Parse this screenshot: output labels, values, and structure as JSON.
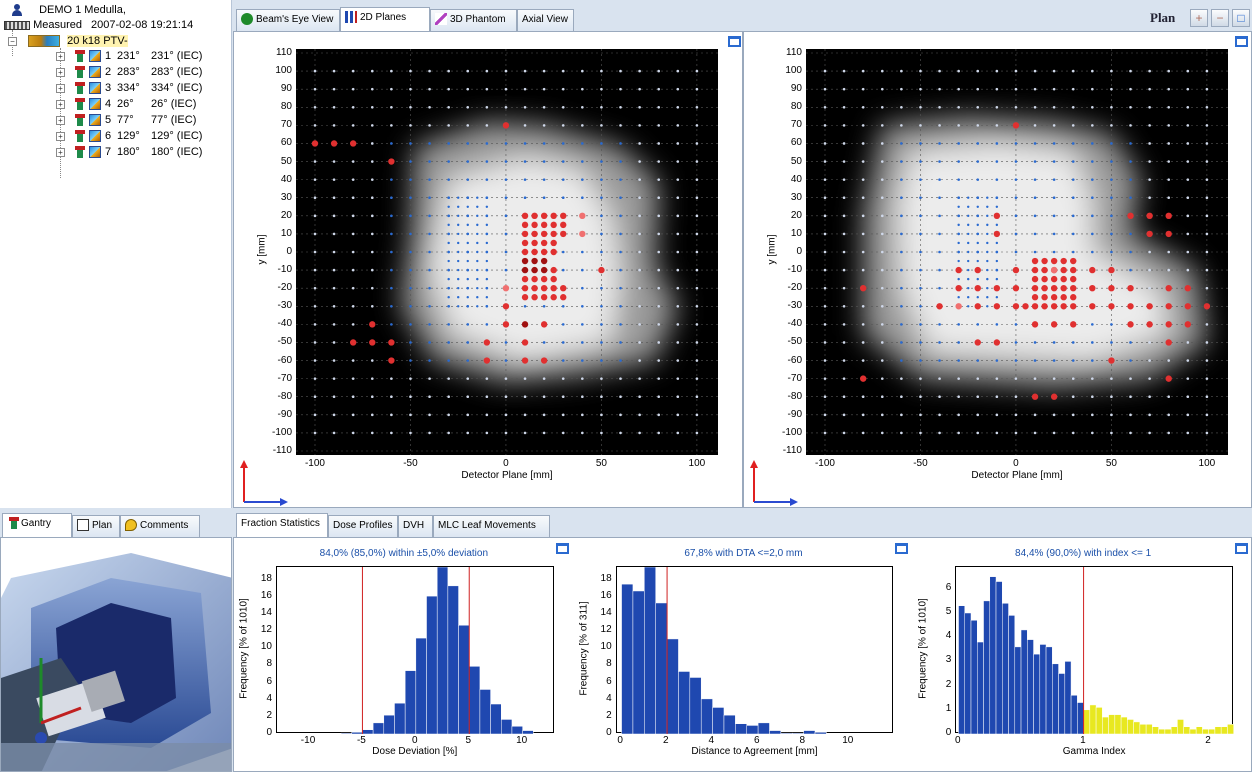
{
  "tree": {
    "patient": "DEMO 1  Medulla,",
    "measured_label": "Measured",
    "measured_time": "2007-02-08 19:21:14",
    "plan_name": "20 k18 PTV-",
    "fields": [
      {
        "id": "1",
        "angle": "231°",
        "iec": "231° (IEC)"
      },
      {
        "id": "2",
        "angle": "283°",
        "iec": "283° (IEC)"
      },
      {
        "id": "3",
        "angle": "334°",
        "iec": "334° (IEC)"
      },
      {
        "id": "4",
        "angle": "26°",
        "iec": "26° (IEC)"
      },
      {
        "id": "5",
        "angle": "77°",
        "iec": "77° (IEC)"
      },
      {
        "id": "6",
        "angle": "129°",
        "iec": "129° (IEC)"
      },
      {
        "id": "7",
        "angle": "180°",
        "iec": "180° (IEC)"
      }
    ]
  },
  "top_tabs": [
    "Beam's Eye View",
    "2D Planes",
    "3D Phantom",
    "Axial View"
  ],
  "active_top_tab": "2D Planes",
  "plan_title": "Plan",
  "planes": {
    "ylabel": "y [mm]",
    "xlabel": "Detector Plane [mm]",
    "y_ticks": [
      "110",
      "100",
      "90",
      "80",
      "70",
      "60",
      "50",
      "40",
      "30",
      "20",
      "10",
      "0",
      "-10",
      "-20",
      "-30",
      "-40",
      "-50",
      "-60",
      "-70",
      "-80",
      "-90",
      "-100",
      "-110"
    ],
    "x_ticks": [
      "-100",
      "-50",
      "0",
      "50",
      "100"
    ]
  },
  "left_tabs": [
    "Gantry",
    "Plan",
    "Comments"
  ],
  "stat_tabs": [
    "Fraction Statistics",
    "Dose Profiles",
    "DVH",
    "MLC Leaf Movements"
  ],
  "histograms": [
    {
      "title": "84,0% (85,0%) within ±5,0% deviation",
      "ylabel": "Frequency [% of 1010]",
      "xlabel": "Dose Deviation [%]",
      "x_ticks": [
        "-10",
        "-5",
        "0",
        "5",
        "10"
      ],
      "y_ticks": [
        "18",
        "16",
        "14",
        "12",
        "10",
        "8",
        "6",
        "4",
        "2",
        "0"
      ]
    },
    {
      "title": "67,8% with DTA <=2,0 mm",
      "ylabel": "Frequency [% of 311]",
      "xlabel": "Distance to Agreement [mm]",
      "x_ticks": [
        "0",
        "2",
        "4",
        "6",
        "8",
        "10"
      ],
      "y_ticks": [
        "18",
        "16",
        "14",
        "12",
        "10",
        "8",
        "6",
        "4",
        "2",
        "0"
      ]
    },
    {
      "title": "84,4% (90,0%) with index <= 1",
      "ylabel": "Frequency [% of 1010]",
      "xlabel": "Gamma Index",
      "x_ticks": [
        "0",
        "1",
        "2"
      ],
      "y_ticks": [
        "6",
        "5",
        "4",
        "3",
        "2",
        "1",
        "0"
      ]
    }
  ],
  "chart_data": [
    {
      "type": "bar",
      "xlim": [
        -13,
        13
      ],
      "ylim": [
        0,
        19.5
      ],
      "threshold_lines": [
        -5,
        5
      ],
      "bin_width": 1,
      "x": [
        -6.5,
        -5.5,
        -4.5,
        -3.5,
        -2.5,
        -1.5,
        -0.5,
        0.5,
        1.5,
        2.5,
        3.5,
        4.5,
        5.5,
        6.5,
        7.5,
        8.5,
        9.5,
        10.5
      ],
      "values": [
        0.1,
        0.2,
        0.5,
        1.3,
        2.2,
        3.6,
        7.4,
        11.2,
        16.1,
        19.5,
        17.3,
        12.7,
        7.9,
        5.2,
        3.5,
        1.7,
        0.9,
        0.4
      ],
      "xlabel": "Dose Deviation [%]",
      "ylabel": "Frequency [% of 1010]"
    },
    {
      "type": "bar",
      "xlim": [
        -0.2,
        12
      ],
      "ylim": [
        0,
        19.5
      ],
      "threshold_lines": [
        2
      ],
      "bin_width": 0.5,
      "x": [
        0.25,
        0.75,
        1.25,
        1.75,
        2.25,
        2.75,
        3.25,
        3.75,
        4.25,
        4.75,
        5.25,
        5.75,
        6.25,
        6.75,
        7.25,
        7.75,
        8.25,
        8.75
      ],
      "values": [
        17.5,
        16.7,
        19.5,
        15.3,
        11.1,
        7.3,
        6.6,
        4.1,
        3.1,
        2.2,
        1.2,
        1.0,
        1.3,
        0.4,
        0.1,
        0.1,
        0.4,
        0.2
      ],
      "xlabel": "Distance to Agreement [mm]",
      "ylabel": "Frequency [% of 311]"
    },
    {
      "type": "bar",
      "xlim": [
        -0.02,
        2.2
      ],
      "ylim": [
        0,
        6.9
      ],
      "threshold_lines": [
        1
      ],
      "bin_width": 0.05,
      "x": [
        0.025,
        0.075,
        0.125,
        0.175,
        0.225,
        0.275,
        0.325,
        0.375,
        0.425,
        0.475,
        0.525,
        0.575,
        0.625,
        0.675,
        0.725,
        0.775,
        0.825,
        0.875,
        0.925,
        0.975,
        1.025,
        1.075,
        1.125,
        1.175,
        1.225,
        1.275,
        1.325,
        1.375,
        1.425,
        1.475,
        1.525,
        1.575,
        1.625,
        1.675,
        1.725,
        1.775,
        1.825,
        1.875,
        1.925,
        1.975,
        2.025,
        2.075,
        2.125,
        2.175
      ],
      "values": [
        5.3,
        5.0,
        4.7,
        3.8,
        5.5,
        6.5,
        6.3,
        5.4,
        4.9,
        3.6,
        4.3,
        3.9,
        3.3,
        3.7,
        3.6,
        2.9,
        2.5,
        3.0,
        1.6,
        1.3,
        1.0,
        1.2,
        1.1,
        0.7,
        0.8,
        0.8,
        0.7,
        0.6,
        0.5,
        0.4,
        0.4,
        0.3,
        0.2,
        0.2,
        0.3,
        0.6,
        0.3,
        0.2,
        0.3,
        0.2,
        0.2,
        0.3,
        0.3,
        0.4
      ],
      "series": [
        {
          "name": "",
          "color": "#1f48b0"
        },
        {
          "name": "",
          "color": "#e8e820"
        }
      ],
      "xlabel": "Gamma Index",
      "ylabel": "Frequency [% of 1010]"
    }
  ],
  "colors": {
    "accent": "#1f48b0",
    "threshold": "#d02020",
    "fail_bar": "#e8e820",
    "panel_border": "#9aa9bd"
  }
}
